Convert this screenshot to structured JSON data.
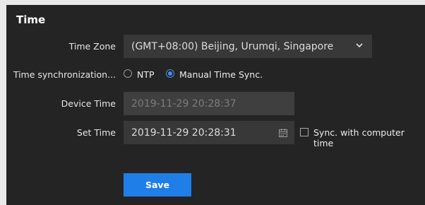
{
  "section": {
    "title": "Time"
  },
  "time_zone": {
    "label": "Time Zone",
    "value": "(GMT+08:00) Beijing, Urumqi, Singapore"
  },
  "time_sync": {
    "label": "Time synchronization...",
    "options": [
      {
        "label": "NTP",
        "selected": false
      },
      {
        "label": "Manual Time Sync.",
        "selected": true
      }
    ]
  },
  "device_time": {
    "label": "Device Time",
    "value": "2019-11-29 20:28:37"
  },
  "set_time": {
    "label": "Set Time",
    "value": "2019-11-29 20:28:31",
    "sync_checkbox_label": "Sync. with computer time",
    "sync_checked": false
  },
  "actions": {
    "save_label": "Save"
  },
  "colors": {
    "panel_bg": "#242424",
    "field_bg": "#383838",
    "accent": "#1f7ee8",
    "radio_accent": "#4a8cf0"
  },
  "icons": {
    "dropdown": "chevron-down-icon",
    "calendar": "calendar-icon"
  }
}
